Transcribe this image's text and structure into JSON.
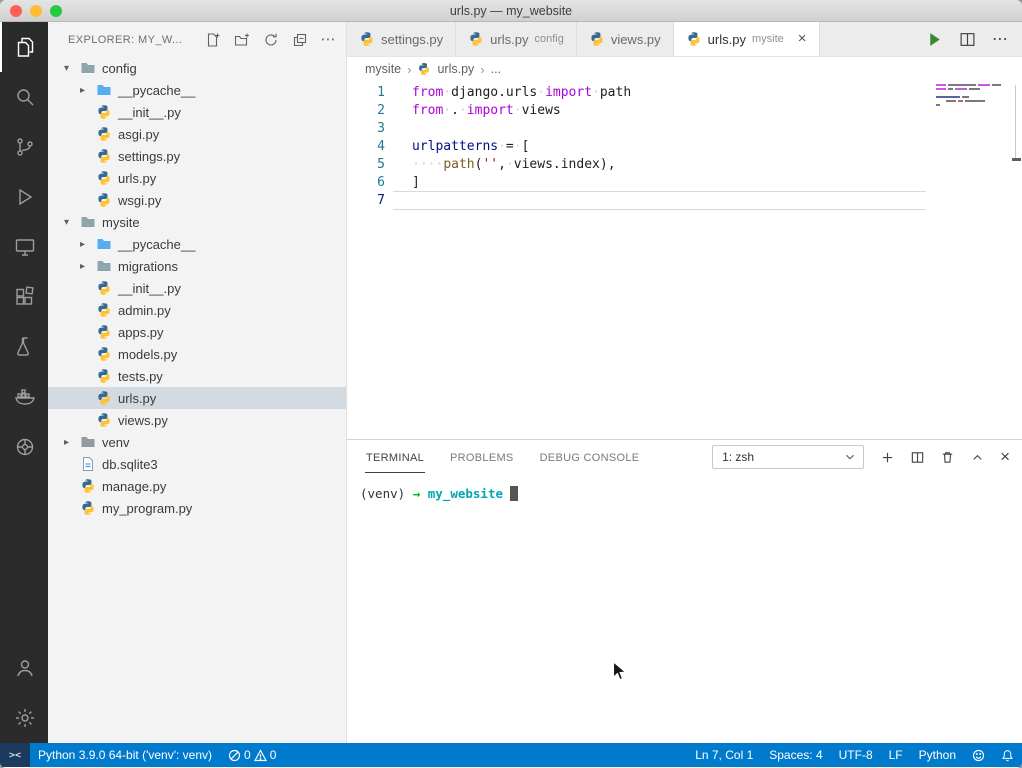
{
  "colors": {
    "accent": "#007acc",
    "keyword": "#af00db",
    "string": "#a31515",
    "selection": "#d4dae2"
  },
  "titlebar": {
    "title": "urls.py — my_website"
  },
  "sidebar": {
    "header": "EXPLORER: MY_W...",
    "tree": [
      {
        "label": "config"
      },
      {
        "label": "__pycache__"
      },
      {
        "label": "__init__.py"
      },
      {
        "label": "asgi.py"
      },
      {
        "label": "settings.py"
      },
      {
        "label": "urls.py"
      },
      {
        "label": "wsgi.py"
      },
      {
        "label": "mysite"
      },
      {
        "label": "__pycache__"
      },
      {
        "label": "migrations"
      },
      {
        "label": "__init__.py"
      },
      {
        "label": "admin.py"
      },
      {
        "label": "apps.py"
      },
      {
        "label": "models.py"
      },
      {
        "label": "tests.py"
      },
      {
        "label": "urls.py"
      },
      {
        "label": "views.py"
      },
      {
        "label": "venv"
      },
      {
        "label": "db.sqlite3"
      },
      {
        "label": "manage.py"
      },
      {
        "label": "my_program.py"
      }
    ]
  },
  "tabs": {
    "items": [
      {
        "label": "settings.py"
      },
      {
        "label": "urls.py",
        "detail": "config"
      },
      {
        "label": "views.py"
      },
      {
        "label": "urls.py",
        "detail": "mysite"
      }
    ]
  },
  "breadcrumb": {
    "items": [
      "mysite",
      "urls.py",
      "..."
    ]
  },
  "editor": {
    "lines": [
      {
        "num": "1",
        "tokens": [
          {
            "t": "from",
            "c": "t-kw"
          },
          {
            "t": "·",
            "c": "t-ws"
          },
          {
            "t": "django.urls",
            "c": "t-plain"
          },
          {
            "t": "·",
            "c": "t-ws"
          },
          {
            "t": "import",
            "c": "t-kw"
          },
          {
            "t": "·",
            "c": "t-ws"
          },
          {
            "t": "path",
            "c": "t-plain"
          }
        ]
      },
      {
        "num": "2",
        "tokens": [
          {
            "t": "from",
            "c": "t-kw"
          },
          {
            "t": "·",
            "c": "t-ws"
          },
          {
            "t": ".",
            "c": "t-plain"
          },
          {
            "t": "·",
            "c": "t-ws"
          },
          {
            "t": "import",
            "c": "t-kw"
          },
          {
            "t": "·",
            "c": "t-ws"
          },
          {
            "t": "views",
            "c": "t-plain"
          }
        ]
      },
      {
        "num": "3",
        "tokens": []
      },
      {
        "num": "4",
        "tokens": [
          {
            "t": "urlpatterns",
            "c": "t-var"
          },
          {
            "t": "·",
            "c": "t-ws"
          },
          {
            "t": "=",
            "c": "t-plain"
          },
          {
            "t": "·",
            "c": "t-ws"
          },
          {
            "t": "[",
            "c": "t-plain"
          }
        ]
      },
      {
        "num": "5",
        "tokens": [
          {
            "t": "····",
            "c": "t-ws"
          },
          {
            "t": "path",
            "c": "t-fn"
          },
          {
            "t": "(",
            "c": "t-plain"
          },
          {
            "t": "''",
            "c": "t-str"
          },
          {
            "t": ",",
            "c": "t-plain"
          },
          {
            "t": "·",
            "c": "t-ws"
          },
          {
            "t": "views.index",
            "c": "t-plain"
          },
          {
            "t": ")",
            "c": "t-plain"
          },
          {
            "t": ",",
            "c": "t-plain"
          }
        ]
      },
      {
        "num": "6",
        "tokens": [
          {
            "t": "]",
            "c": "t-plain"
          }
        ]
      },
      {
        "num": "7",
        "tokens": []
      }
    ]
  },
  "terminal": {
    "tabs": [
      {
        "label": "TERMINAL"
      },
      {
        "label": "PROBLEMS"
      },
      {
        "label": "DEBUG CONSOLE"
      }
    ],
    "shell": "1: zsh",
    "prompt": {
      "venv": "(venv)",
      "arrow": "→",
      "cwd": "my_website"
    }
  },
  "statusbar": {
    "interpreter": "Python 3.9.0 64-bit ('venv': venv)",
    "errors": "0",
    "warnings": "0",
    "line_col": "Ln 7, Col 1",
    "spaces": "Spaces: 4",
    "encoding": "UTF-8",
    "eol": "LF",
    "language": "Python"
  }
}
